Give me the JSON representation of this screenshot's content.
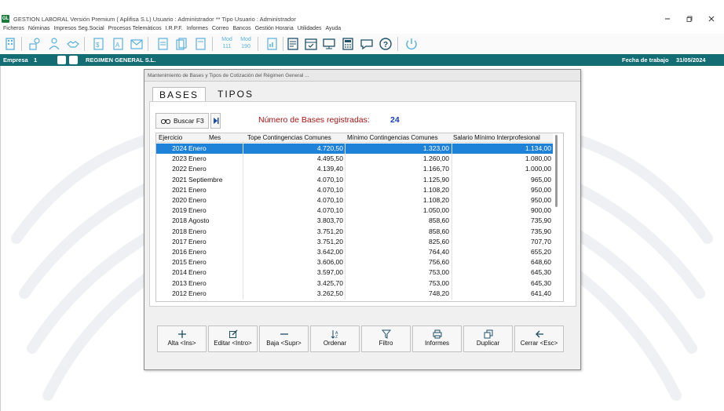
{
  "app": {
    "logo_text": "GL",
    "title": "GESTION LABORAL Versión Premium ( Aplifisa S.L)   Usuario : Administrador  **  Tipo Usuario : Administrador",
    "controls": [
      "minimize",
      "restore",
      "close"
    ]
  },
  "menu": [
    "Ficheros",
    "Nóminas",
    "Impresos Seg.Social",
    "Procesos Telemáticos",
    "I.R.P.F.",
    "Informes",
    "Correo",
    "Bancos",
    "Gestión Horaria",
    "Utilidades",
    "Ayuda"
  ],
  "toolbar": {
    "mod111": "Mod\n111",
    "mod190": "Mod\n190",
    "accent": "#4aa8d8"
  },
  "empresa_bar": {
    "label": "Empresa",
    "number": "1",
    "name": "REGIMEN GENERAL  S.L.",
    "fecha_label": "Fecha de trabajo",
    "fecha_value": "31/05/2024",
    "color": "#136d73"
  },
  "dialog": {
    "title": "Mantenimiento de Bases y Tipos de Cotización del Régimen General ...",
    "tabs": [
      "BASES",
      "TIPOS"
    ],
    "active_tab": "BASES",
    "search_label": "Buscar F3",
    "count_label": "Número de Bases registradas:",
    "count_value": "24",
    "columns": [
      "Ejercicio",
      "Mes",
      "Tope Contingencias Comunes",
      "Mínimo Contingencias Comunes",
      "Salario Mínimo Interprofesional"
    ],
    "rows": [
      [
        "2024",
        "Enero",
        "4.720,50",
        "1.323,00",
        "1.134,00"
      ],
      [
        "2023",
        "Enero",
        "4.495,50",
        "1.260,00",
        "1.080,00"
      ],
      [
        "2022",
        "Enero",
        "4.139,40",
        "1.166,70",
        "1.000,00"
      ],
      [
        "2021",
        "Septiembre",
        "4.070,10",
        "1.125,90",
        "965,00"
      ],
      [
        "2021",
        "Enero",
        "4.070,10",
        "1.108,20",
        "950,00"
      ],
      [
        "2020",
        "Enero",
        "4.070,10",
        "1.108,20",
        "950,00"
      ],
      [
        "2019",
        "Enero",
        "4.070,10",
        "1.050,00",
        "900,00"
      ],
      [
        "2018",
        "Agosto",
        "3.803,70",
        "858,60",
        "735,90"
      ],
      [
        "2018",
        "Enero",
        "3.751,20",
        "858,60",
        "735,90"
      ],
      [
        "2017",
        "Enero",
        "3.751,20",
        "825,60",
        "707,70"
      ],
      [
        "2016",
        "Enero",
        "3.642,00",
        "764,40",
        "655,20"
      ],
      [
        "2015",
        "Enero",
        "3.606,00",
        "756,60",
        "648,60"
      ],
      [
        "2014",
        "Enero",
        "3.597,00",
        "753,00",
        "645,30"
      ],
      [
        "2013",
        "Enero",
        "3.425,70",
        "753,00",
        "645,30"
      ],
      [
        "2012",
        "Enero",
        "3.262,50",
        "748,20",
        "641,40"
      ]
    ],
    "selected_row": 0,
    "selection_color": "#1e82d8",
    "actions": [
      {
        "label": "Alta <Ins>",
        "icon": "plus-icon"
      },
      {
        "label": "Editar <Intro>",
        "icon": "edit-icon"
      },
      {
        "label": "Baja <Supr>",
        "icon": "minus-icon"
      },
      {
        "label": "Ordenar",
        "icon": "sort-az-icon"
      },
      {
        "label": "Filtro",
        "icon": "filter-icon"
      },
      {
        "label": "Informes",
        "icon": "printer-icon"
      },
      {
        "label": "Duplicar",
        "icon": "duplicate-icon"
      },
      {
        "label": "Cerrar <Esc>",
        "icon": "arrow-left-icon"
      }
    ]
  }
}
